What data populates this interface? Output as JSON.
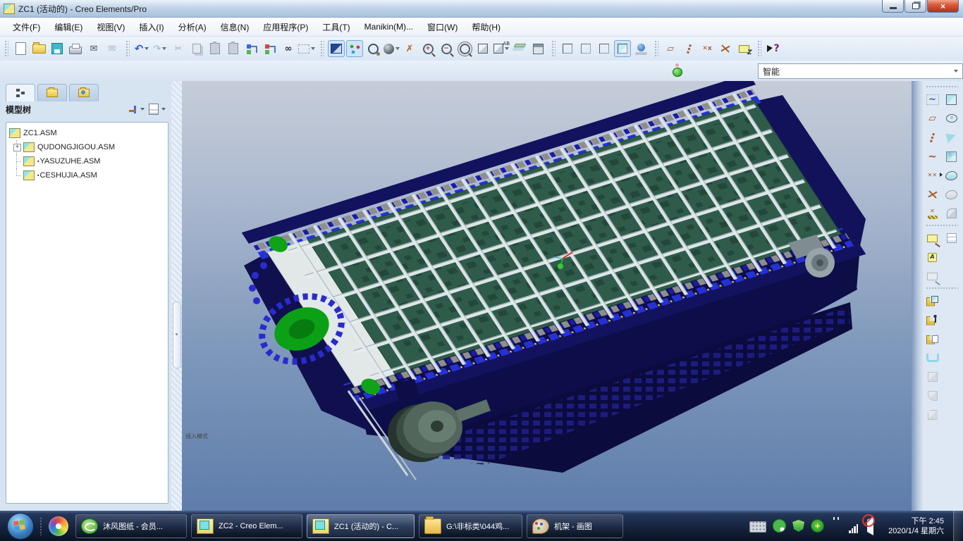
{
  "window": {
    "title": "ZC1 (活动的) - Creo Elements/Pro",
    "controls": {
      "close": "×"
    }
  },
  "menu": {
    "items": [
      "文件(F)",
      "编辑(E)",
      "视图(V)",
      "插入(I)",
      "分析(A)",
      "信息(N)",
      "应用程序(P)",
      "工具(T)",
      "Manikin(M)...",
      "窗口(W)",
      "帮助(H)"
    ]
  },
  "toolbar": {
    "selection_filter": "智能",
    "main_icons": [
      "new-file",
      "open",
      "save",
      "print",
      "send-mail",
      "mail-link",
      "undo",
      "redo",
      "cut",
      "copy",
      "paste",
      "paste-special",
      "regenerate",
      "regen-manager",
      "find",
      "select-box",
      "repaint",
      "spin-center",
      "orient-mode",
      "display-style",
      "deselect",
      "zoom-in",
      "zoom-out",
      "refit",
      "reorient",
      "saved-views",
      "layers",
      "view-manager",
      "wireframe",
      "hidden-line",
      "no-hidden",
      "shaded",
      "perspective",
      "datum-planes",
      "datum-axes",
      "datum-points",
      "datum-csys",
      "annotations",
      "context-help"
    ]
  },
  "icon_glyphs": {
    "send-mail": "✉",
    "mail-link": "✉",
    "undo": "↶",
    "redo": "↷",
    "cut": "✂",
    "find": "∞",
    "zoom-in": "+",
    "zoom-out": "−",
    "saved-views": "AB",
    "deselect": "✗",
    "datum-planes": "▱",
    "datum-points": "✕x",
    "annotations": "Z",
    "context-help": "?",
    "close": "×",
    "sketch": "~",
    "curve": "~",
    "points": "✕✕",
    "offset-points": "✕",
    "balloon-a": "A"
  },
  "model_tree": {
    "title": "模型树",
    "nodes": [
      {
        "label": "ZC1.ASM"
      },
      {
        "label": "QUDONGJIGOU.ASM",
        "expander": "+"
      },
      {
        "label": "YASUZUHE.ASM",
        "mark": "▪"
      },
      {
        "label": "CESHUJIA.ASM",
        "mark": "▪"
      }
    ]
  },
  "viewport": {
    "status_text": "插入模式"
  },
  "right_toolbar": {
    "icons": [
      "sketch-tool",
      "datum-plane",
      "datum-axis",
      "curve",
      "datum-point",
      "datum-csys",
      "offset-points",
      "note",
      "balloon-note",
      "note-group",
      "assemble-component",
      "manikin",
      "create-component",
      "slot",
      "shell",
      "round",
      "chamfer",
      "extrude",
      "revolve",
      "sweep",
      "swept-blend",
      "boundary-blend",
      "merge",
      "trim",
      "pattern"
    ]
  },
  "taskbar": {
    "buttons": [
      {
        "label": "沐风图纸 - 会员..."
      },
      {
        "label": "ZC2 - Creo Elem..."
      },
      {
        "label": "ZC1 (活动的) - C..."
      },
      {
        "label": "G:\\非标类\\044鸡..."
      },
      {
        "label": "机架 - 画图"
      }
    ],
    "tray": {
      "icons": [
        "input-keyboard",
        "wechat",
        "security-shield",
        "360-safe",
        "power-plug",
        "network-signal",
        "volume-muted"
      ],
      "time": "下午 2:45",
      "date": "2020/1/4 星期六"
    }
  }
}
